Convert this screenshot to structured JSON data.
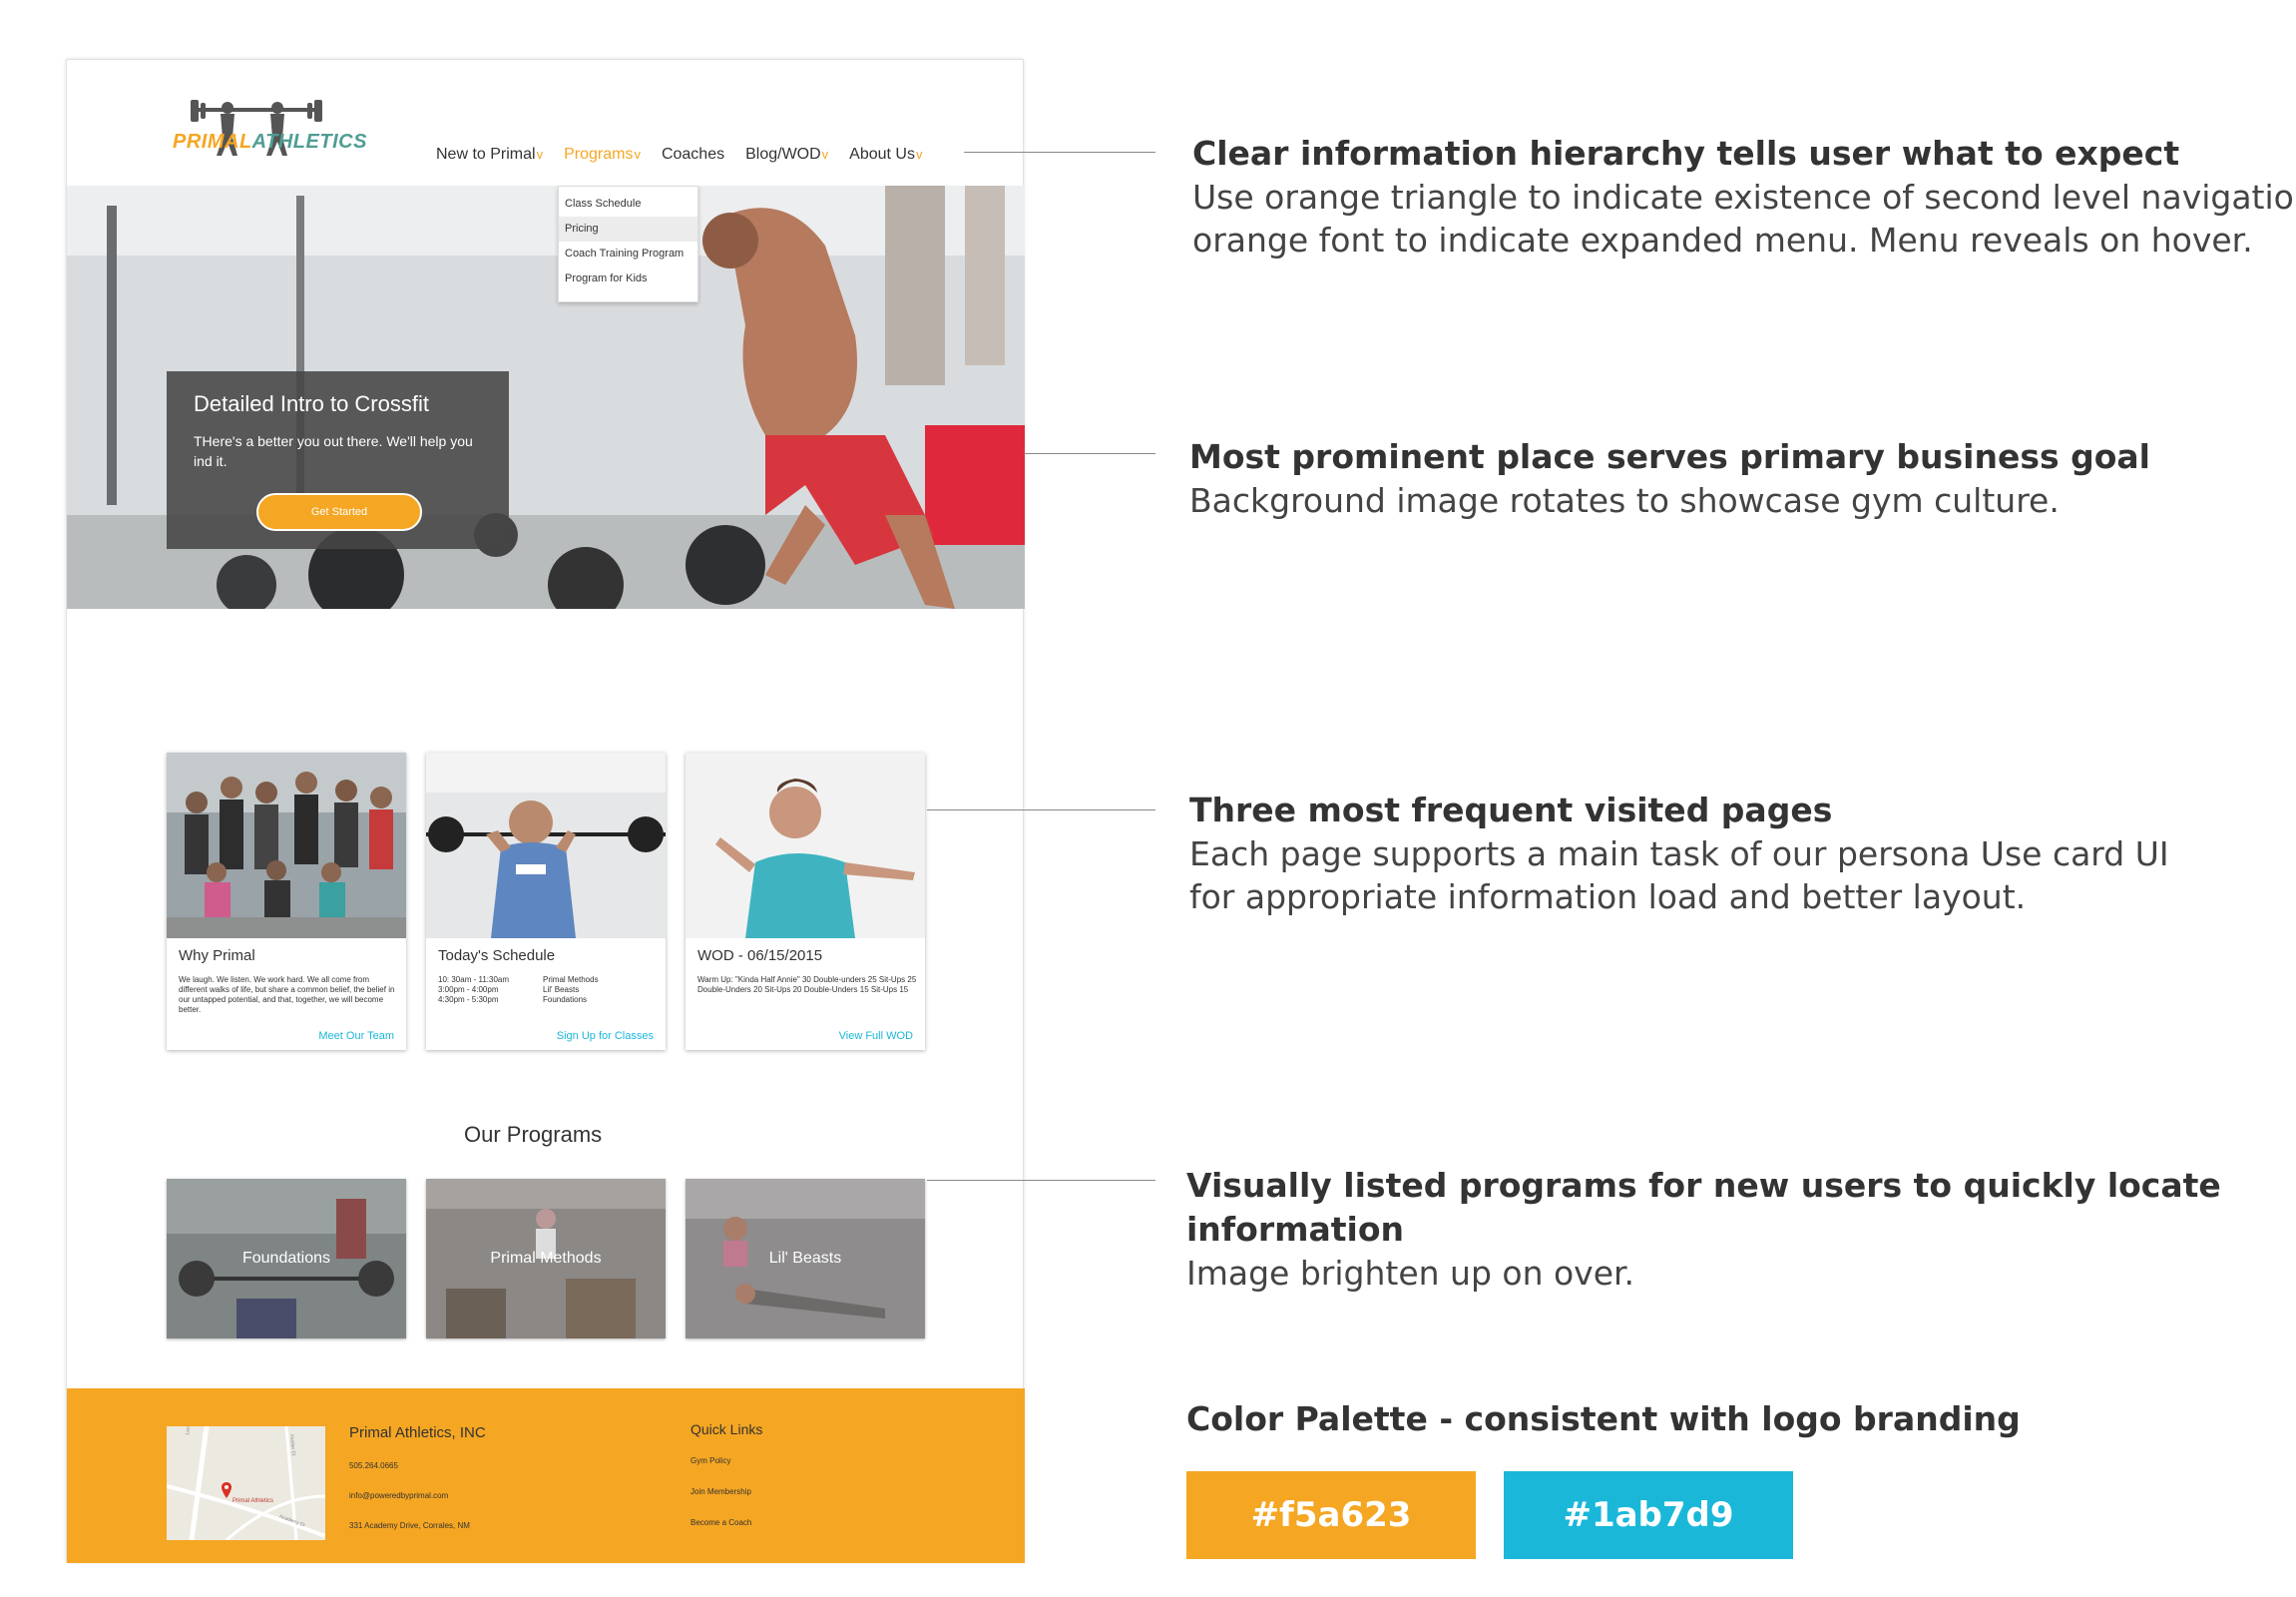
{
  "brand": {
    "logo_part1": "PRIMAL",
    "logo_part2": "ATHLETICS",
    "orange": "#f5a623",
    "teal": "#1ab7d9"
  },
  "nav": {
    "items": [
      {
        "label": "New to Primal",
        "caret": "v"
      },
      {
        "label": "Programs",
        "caret": "v"
      },
      {
        "label": "Coaches",
        "caret": ""
      },
      {
        "label": "Blog/WOD",
        "caret": "v"
      },
      {
        "label": "About Us",
        "caret": "v"
      }
    ],
    "dropdown": [
      "Class Schedule",
      "Pricing",
      "Coach Training Program",
      "Program for Kids"
    ]
  },
  "hero": {
    "title": "Detailed Intro to Crossfit",
    "text": "THere's a better you out there. We'll help you ind it.",
    "button": "Get Started"
  },
  "cards": [
    {
      "title": "Why Primal",
      "body": "We laugh. We listen. We work hard. We all come from different walks of life, but share a common belief, the belief in our untapped potential, and that, together, we will become better.",
      "link": "Meet Our Team"
    },
    {
      "title": "Today's Schedule",
      "schedule": [
        {
          "time": "10: 30am - 11:30am",
          "class": "Primal Methods"
        },
        {
          "time": "3:00pm - 4:00pm",
          "class": "Lil' Beasts"
        },
        {
          "time": "4:30pm - 5:30pm",
          "class": "Foundations"
        }
      ],
      "link": "Sign Up for Classes"
    },
    {
      "title": "WOD - 06/15/2015",
      "body": "Warm Up: \"Kinda Half Annie\" 30 Double-unders 25 Sit-Ups 25 Double-Unders 20 Sit-Ups 20 Double-Unders 15 Sit-Ups 15",
      "link": "View Full WOD"
    }
  ],
  "programs": {
    "title": "Our Programs",
    "items": [
      "Foundations",
      "Primal Methods",
      "Lil' Beasts"
    ]
  },
  "footer": {
    "company": "Primal Athletics, INC",
    "phone": "505.264.0665",
    "email": "info@poweredbyprimal.com",
    "address": "331 Academy Drive, Corrales, NM",
    "map_label": "Primal Athletics",
    "map_streets": [
      "Loma Larga",
      "Academy Dr",
      "Hunter Ct"
    ],
    "quick_links_title": "Quick Links",
    "quick_links": [
      "Gym Policy",
      "Join Membership",
      "Become a Coach"
    ]
  },
  "annotations": [
    {
      "heading": "Clear information hierarchy tells user what to expect",
      "lines": [
        "Use orange triangle to indicate existence of second level navigation,",
        "orange font to indicate expanded menu. Menu reveals on hover."
      ]
    },
    {
      "heading": "Most prominent place serves primary business goal",
      "lines": [
        "Background image rotates to showcase gym culture."
      ]
    },
    {
      "heading": "Three most frequent visited pages",
      "lines": [
        "Each page supports a main task of our persona Use card UI",
        "for appropriate information load and better layout."
      ]
    },
    {
      "heading": "Visually listed programs for new users to quickly locate",
      "heading2": "information",
      "lines": [
        "Image brighten up on over."
      ]
    }
  ],
  "palette": {
    "title": "Color Palette - consistent with logo branding",
    "swatches": [
      "#f5a623",
      "#1ab7d9"
    ]
  }
}
